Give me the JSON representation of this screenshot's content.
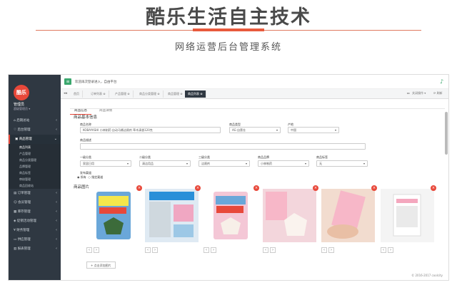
{
  "hero": {
    "title": "酷乐生活自主技术",
    "subtitle": "网络运营后台管理系统"
  },
  "sidebar": {
    "logo_text": "酷乐",
    "user_name": "管理员",
    "user_role": "超级管理员 ▾",
    "menu": [
      {
        "label": "后期总站",
        "icon": "home-icon"
      },
      {
        "label": "后台管理",
        "icon": "shield-icon"
      },
      {
        "label": "商品管理",
        "icon": "cart-icon",
        "active": true
      },
      {
        "label": "订单管理",
        "icon": "order-icon"
      },
      {
        "label": "会员管理",
        "icon": "user-icon"
      },
      {
        "label": "库存管理",
        "icon": "box-icon"
      },
      {
        "label": "促销活动管理",
        "icon": "tag-icon"
      },
      {
        "label": "财务管理",
        "icon": "money-icon"
      },
      {
        "label": "供应管理",
        "icon": "truck-icon"
      },
      {
        "label": "报表管理",
        "icon": "chart-icon"
      }
    ],
    "submenu": [
      "商品列表",
      "产品管理",
      "商品分类管理",
      "品牌管理",
      "商品标签",
      "审核管理",
      "商品回收站"
    ]
  },
  "topbar": {
    "message": "欢迎再次登录进入，自由平台",
    "menu_icon": "menu-icon",
    "notify_icon": "bell-icon"
  },
  "tabs": {
    "nav_prev": "◂◂",
    "items": [
      "首页",
      "订单列表 ⊗",
      "产品管理 ⊗",
      "商品分类管理 ⊗",
      "商品管理 ⊗",
      "商品列表 ⊗"
    ],
    "active_index": 5,
    "right_label": "关闭操作 ▾",
    "nav_next": "▸▸",
    "refresh": "⟳ 刷新"
  },
  "subtabs": [
    "商品信息",
    "商品详情"
  ],
  "form": {
    "section_basic": "商品基本信息",
    "name_label": "商品名称",
    "name_value": "KOBAYASHI 小林制药 自动马桶洁厕剂 草木清香120克",
    "type_label": "商品类型",
    "type_value": "AG 自营仓",
    "origin_label": "产地",
    "origin_value": "中国",
    "desc_label": "商品描述",
    "cat1_label": "一级分类",
    "cat1_value": "家居日用",
    "cat2_label": "二级分类",
    "cat2_value": "清洁用品",
    "cat3_label": "三级分类",
    "cat3_value": "洁厕剂",
    "brand_label": "商品品牌",
    "brand_value": "小林制药",
    "tag_label": "商品标签",
    "tag_value": "无",
    "publish_label": "发布渠道",
    "publish_opt1": "所有",
    "publish_opt2": "指定渠道",
    "section_images": "商品图片",
    "add_image": "+ 点击添加图片"
  },
  "images": [
    {
      "alt": "product-image-1",
      "bg": "#6aa7d9"
    },
    {
      "alt": "product-image-2",
      "bg": "#8cc0e6"
    },
    {
      "alt": "product-image-3",
      "bg": "#f4c7d6"
    },
    {
      "alt": "product-image-4",
      "bg": "#f3d6dc"
    },
    {
      "alt": "product-image-5",
      "bg": "#f2dccf"
    },
    {
      "alt": "product-image-6",
      "bg": "#f4f4f4"
    }
  ],
  "footer": "© 2016-2017 coolcity",
  "colors": {
    "accent": "#e8483a",
    "sidebar": "#2f3842",
    "green": "#3aa76d"
  }
}
